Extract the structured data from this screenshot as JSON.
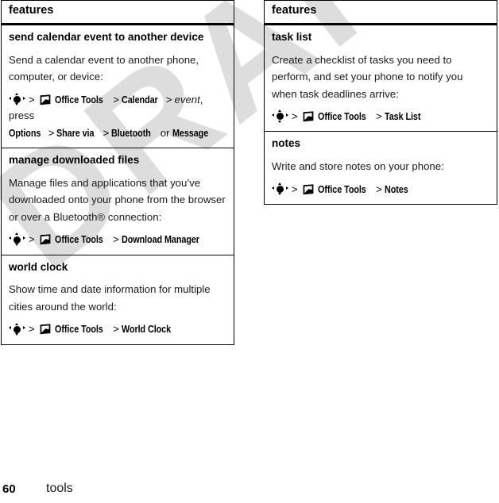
{
  "page": {
    "footer_page_number": "60",
    "footer_section": "tools",
    "watermark_text": "DRAFT"
  },
  "icons": {
    "nav_key": "nav-key-icon",
    "office_tools": "office-tools-icon"
  },
  "columns": [
    {
      "header": "features",
      "features": [
        {
          "title": "send calendar event to another device",
          "description": "Send a calendar event to another phone, computer, or device:",
          "paths": [
            [
              {
                "type": "icon",
                "icon": "nav-key"
              },
              {
                "type": "sep",
                "text": ">"
              },
              {
                "type": "icon",
                "icon": "office-tools"
              },
              {
                "type": "term",
                "text": "Office Tools"
              },
              {
                "type": "sep",
                "text": ">"
              },
              {
                "type": "term",
                "text": "Calendar"
              },
              {
                "type": "sep",
                "text": ">"
              },
              {
                "type": "italic",
                "text": "event"
              },
              {
                "type": "plain",
                "text": ", press"
              }
            ],
            [
              {
                "type": "term",
                "text": "Options"
              },
              {
                "type": "sep",
                "text": ">"
              },
              {
                "type": "term",
                "text": "Share via"
              },
              {
                "type": "sep",
                "text": ">"
              },
              {
                "type": "term",
                "text": "Bluetooth"
              },
              {
                "type": "plain",
                "text": " or "
              },
              {
                "type": "term",
                "text": "Message"
              }
            ]
          ]
        },
        {
          "title": "manage downloaded files",
          "description": "Manage files and applications that you’ve downloaded onto your phone from the browser or over a Bluetooth® connection:",
          "paths": [
            [
              {
                "type": "icon",
                "icon": "nav-key"
              },
              {
                "type": "sep",
                "text": ">"
              },
              {
                "type": "icon",
                "icon": "office-tools"
              },
              {
                "type": "term",
                "text": "Office Tools"
              },
              {
                "type": "sep",
                "text": ">"
              },
              {
                "type": "term",
                "text": "Download Manager"
              }
            ]
          ]
        },
        {
          "title": "world clock",
          "description": "Show time and date information for multiple cities around the world:",
          "paths": [
            [
              {
                "type": "icon",
                "icon": "nav-key"
              },
              {
                "type": "sep",
                "text": ">"
              },
              {
                "type": "icon",
                "icon": "office-tools"
              },
              {
                "type": "term",
                "text": "Office Tools"
              },
              {
                "type": "sep",
                "text": ">"
              },
              {
                "type": "term",
                "text": "World Clock"
              }
            ]
          ]
        }
      ]
    },
    {
      "header": "features",
      "features": [
        {
          "title": "task list",
          "description": "Create a checklist of tasks you need to perform, and set your phone to notify you when task deadlines arrive:",
          "paths": [
            [
              {
                "type": "icon",
                "icon": "nav-key"
              },
              {
                "type": "sep",
                "text": ">"
              },
              {
                "type": "icon",
                "icon": "office-tools"
              },
              {
                "type": "term",
                "text": "Office Tools"
              },
              {
                "type": "sep",
                "text": ">"
              },
              {
                "type": "term",
                "text": "Task List"
              }
            ]
          ]
        },
        {
          "title": "notes",
          "description": "Write and store notes on your phone:",
          "paths": [
            [
              {
                "type": "icon",
                "icon": "nav-key"
              },
              {
                "type": "sep",
                "text": ">"
              },
              {
                "type": "icon",
                "icon": "office-tools"
              },
              {
                "type": "term",
                "text": "Office Tools"
              },
              {
                "type": "sep",
                "text": ">"
              },
              {
                "type": "term",
                "text": "Notes"
              }
            ]
          ]
        }
      ]
    }
  ]
}
